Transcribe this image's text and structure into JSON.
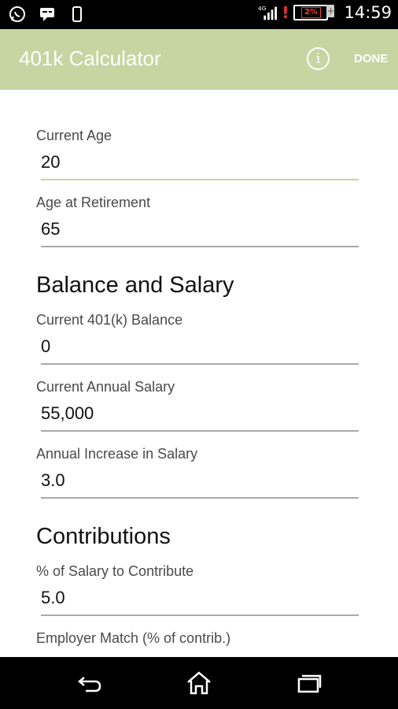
{
  "status_bar": {
    "icons": [
      "whatsapp-icon",
      "message-icon",
      "phone-icon",
      "signal-4g-icon",
      "alert-icon",
      "battery-icon"
    ],
    "network": "4G",
    "battery_level": "2%",
    "time": "14:59"
  },
  "app_bar": {
    "title": "401k Calculator",
    "info_icon": "info-icon",
    "done_label": "DONE",
    "background": "#c7d5a2"
  },
  "form": {
    "current_age": {
      "label": "Current Age",
      "value": "20"
    },
    "retirement_age": {
      "label": "Age at Retirement",
      "value": "65"
    },
    "balance_section_title": "Balance and Salary",
    "balance": {
      "label": "Current 401(k) Balance",
      "value": "0"
    },
    "salary": {
      "label": "Current Annual Salary",
      "value": "55,000"
    },
    "salary_increase": {
      "label": "Annual Increase in Salary",
      "value": "3.0"
    },
    "contributions_section_title": "Contributions",
    "contribution_pct": {
      "label": "% of Salary to Contribute",
      "value": "5.0"
    },
    "employer_match": {
      "label": "Employer Match (% of contrib.)"
    }
  },
  "nav_bar": {
    "icons": [
      "back-icon",
      "home-icon",
      "recent-apps-icon"
    ]
  }
}
